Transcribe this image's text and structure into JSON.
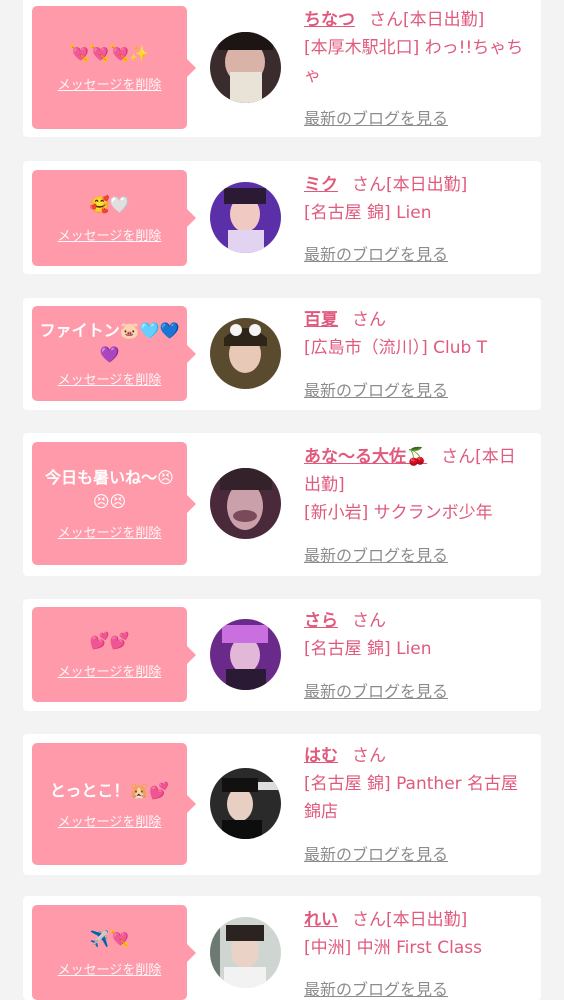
{
  "delete_label": "メッセージを削除",
  "blog_label": "最新のブログを見る",
  "honorific": "さん",
  "colors": {
    "accent": "#e05a7d",
    "bubble": "#ff9aab",
    "link_gray": "#8c8c8c"
  },
  "cards": [
    {
      "message": "💘💘💘✨",
      "name": "ちなつ",
      "status": "[本日出勤]",
      "shop": "[本厚木駅北口] わっ!!ちゃちゃ"
    },
    {
      "message": "🥰🤍",
      "name": "ミク",
      "status": "[本日出勤]",
      "shop": "[名古屋 錦] Lien"
    },
    {
      "message": "ファイトン🐷🩵💙💜",
      "name": "百夏",
      "status": "",
      "shop": "[広島市（流川）] Club T"
    },
    {
      "message": "今日も暑いね〜😣😣😣",
      "name": "あな〜る大佐🍒",
      "status": "[本日出勤]",
      "shop": "[新小岩] サクランボ少年"
    },
    {
      "message": "💕💕",
      "name": "さら",
      "status": "",
      "shop": "[名古屋 錦] Lien"
    },
    {
      "message": "とっとこ！🐹💕",
      "name": "はむ",
      "status": "",
      "shop": "[名古屋 錦] Panther 名古屋錦店"
    },
    {
      "message": "✈️💘",
      "name": "れい",
      "status": "[本日出勤]",
      "shop": "[中洲] 中洲 First Class"
    }
  ]
}
